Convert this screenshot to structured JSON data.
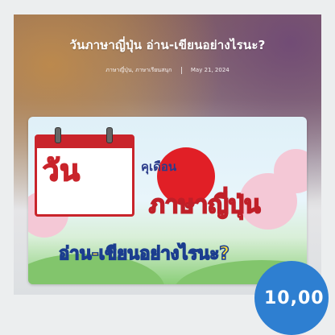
{
  "post": {
    "title": "วันภาษาญี่ปุ่น อ่าน-เขียนอย่างไรนะ?",
    "categories": "ภาษาญี่ปุ่น, ภาษาเรียนสนุก",
    "date": "May 21, 2024"
  },
  "artwork": {
    "day_word": "วัน",
    "day_of": "คุเดือน",
    "japanese_word": "ภาษาญี่ปุ่น",
    "how_to": "อ่าน-เขียนอย่างไรนะ?"
  },
  "badge": {
    "text": "10,00"
  },
  "colors": {
    "sun": "#e11f26",
    "badge": "#2e7fd1",
    "calendar_red": "#c9242b"
  }
}
